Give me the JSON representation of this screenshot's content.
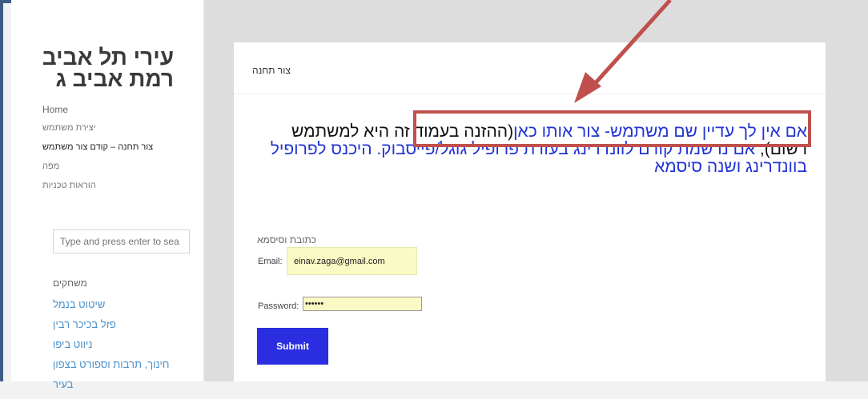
{
  "site": {
    "title": "עירי תל אביב רמת אביב ג"
  },
  "nav": {
    "items": [
      {
        "label": "Home"
      },
      {
        "label": "יצירת משתמש"
      },
      {
        "label": "צור תחנה – קודם צור משתמש"
      },
      {
        "label": "מפה"
      },
      {
        "label": "הוראות טכניות"
      }
    ]
  },
  "search": {
    "placeholder": "Type and press enter to sea"
  },
  "games_widget": {
    "title": "משחקים",
    "links": [
      "שיטוט בנמל",
      "פזל בכיכר רבין",
      "ניווט ביפו",
      "חינוך, תרבות וספורט בצפון",
      "בעיר"
    ]
  },
  "main": {
    "page_title": "צור תחנה",
    "intro_highlight": "אם אין לך עדיין שם משתמש- צור אותו כאן",
    "intro_black": "(ההזנה בעמוד זה היא למשתמש רשום),",
    "intro_blue": " אם נרשמת קודם לוונדרינג בעזרת פרופיל גוגל/פייסבוק. היכנס לפרופיל בוונדרינג ושנה סיסמא",
    "form_heading": "כתובת וסיסמא",
    "email_label": "Email:",
    "email_value": "einav.zaga@gmail.com",
    "password_label": "Password:",
    "password_value": "••••••",
    "submit_label": "Submit"
  },
  "annotation": {
    "color": "#c0504d"
  }
}
